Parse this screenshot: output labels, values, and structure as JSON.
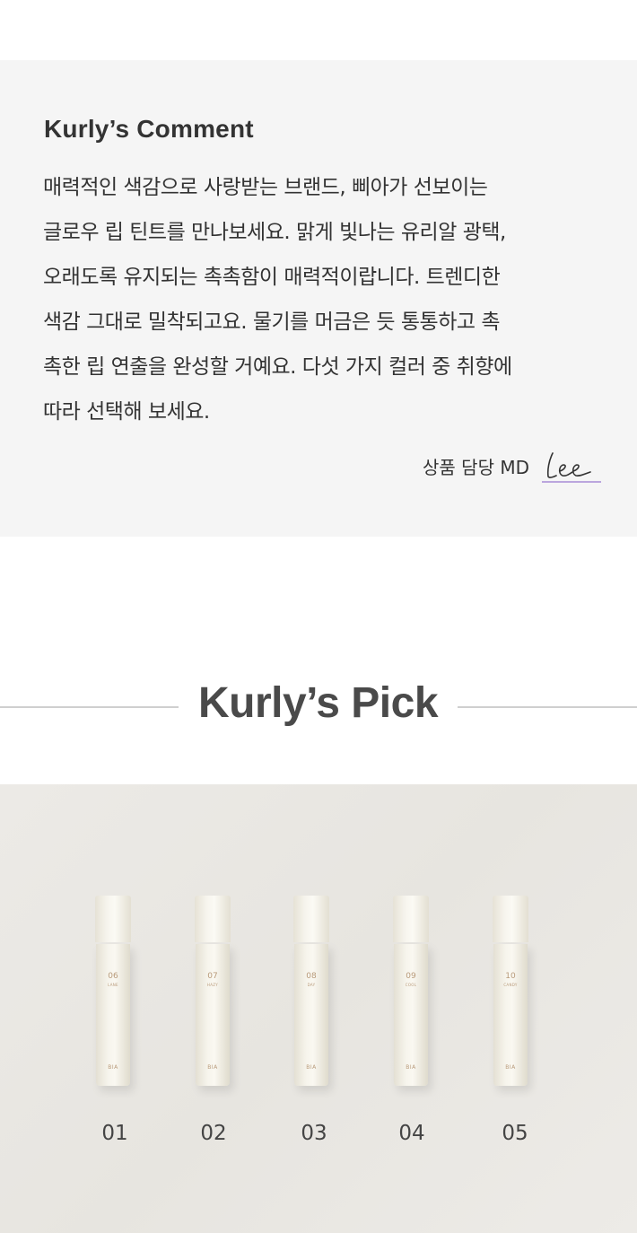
{
  "comment": {
    "title": "Kurly’s Comment",
    "lines": [
      "매력적인 색감으로 사랑받는 브랜드, 삐아가 선보이는",
      "글로우 립 틴트를 만나보세요. 맑게 빛나는 유리알 광택,",
      "오래도록 유지되는 촉촉함이 매력적이랍니다. 트렌디한",
      "색감 그대로 밀착되고요. 물기를 머금은 듯 통통하고 촉",
      "촉한 립 연출을 완성할 거예요. 다섯 가지 컬러 중 취향에",
      "따라 선택해 보세요."
    ],
    "md_label": "상품 담당 MD",
    "signature": "Lee",
    "signature_color": "#a88bd6"
  },
  "pick": {
    "title": "Kurly’s Pick"
  },
  "products": [
    {
      "label": "01",
      "shade_num": "06",
      "shade_name": "LANE",
      "brand": "BIA"
    },
    {
      "label": "02",
      "shade_num": "07",
      "shade_name": "HAZY",
      "brand": "BIA"
    },
    {
      "label": "03",
      "shade_num": "08",
      "shade_name": "DAY",
      "brand": "BIA"
    },
    {
      "label": "04",
      "shade_num": "09",
      "shade_name": "COOL",
      "brand": "BIA"
    },
    {
      "label": "05",
      "shade_num": "10",
      "shade_name": "CANDY",
      "brand": "BIA"
    }
  ]
}
